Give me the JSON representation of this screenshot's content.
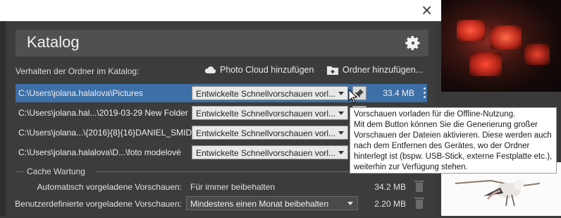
{
  "window": {
    "close_glyph": "×"
  },
  "header": {
    "title": "Katalog",
    "gear_icon": "gear-icon"
  },
  "folders_section": {
    "label": "Verhalten der Ordner im Katalog:",
    "photo_cloud_label": "Photo Cloud hinzufügen",
    "add_folder_label": "Ordner hinzufügen..."
  },
  "folders": [
    {
      "path": "C:\\Users\\jolana.halalova\\Pictures",
      "preview_mode": "Entwickelte Schnellvorschauen vorl...",
      "size": "33.4 MB",
      "selected": true
    },
    {
      "path": "C:\\Users\\jolana.hal...\\2019-03-29 New Folder",
      "preview_mode": "Entwickelte Schnellvorschauen vorl...",
      "size": "",
      "selected": false
    },
    {
      "path": "C:\\Users\\jolana...\\{2016}{8}{16}DANIEL_SMID",
      "preview_mode": "Entwickelte Schnellvorschauen vorl...",
      "size": "",
      "selected": false
    },
    {
      "path": "C:\\Users\\jolana.halalova\\D...\\foto modelové",
      "preview_mode": "Entwickelte Schnellvorschauen vorl...",
      "size": "",
      "selected": false
    }
  ],
  "cache": {
    "section_label": "Cache Wartung",
    "auto_label": "Automatisch vorgeladene Vorschauen:",
    "auto_value": "Für immer beibehalten",
    "auto_size": "34.2 MB",
    "custom_label": "Benutzerdefinierte vorgeladene Vorschauen:",
    "custom_value": "Mindestens einen Monat beibehalten",
    "custom_size": "2.20 MB"
  },
  "tooltip": {
    "lines": [
      "Vorschauen vorladen für die Offline-Nutzung.",
      "Mit dem Button können Sie die Generierung großer",
      "Vorschauen der Dateien aktivieren. Diese werden auch",
      "nach dem Entfernen des Gerätes, wo der Ordner",
      "hinterlegt ist (bspw. USB-Stick, externe Festplatte etc.),",
      "weiterhin zur Verfügung stehen."
    ]
  },
  "colors": {
    "selected_row": "#3d6fa8",
    "panel": "#3c3c3c",
    "header": "#505050"
  }
}
